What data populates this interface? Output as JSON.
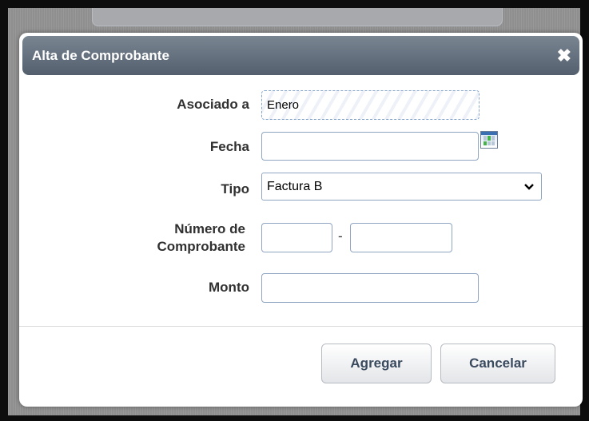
{
  "dialog": {
    "title": "Alta de Comprobante",
    "close_symbol": "✖"
  },
  "form": {
    "asociado_label": "Asociado a",
    "asociado_value": "Enero",
    "fecha_label": "Fecha",
    "fecha_value": "",
    "tipo_label": "Tipo",
    "tipo_selected": "Factura B",
    "numero_label_line1": "Número de",
    "numero_label_line2": "Comprobante",
    "numero_part1": "",
    "numero_separator": "-",
    "numero_part2": "",
    "monto_label": "Monto",
    "monto_value": ""
  },
  "actions": {
    "agregar_label": "Agregar",
    "cancelar_label": "Cancelar"
  },
  "icons": {
    "calendar": "calendar-icon",
    "close": "close-icon",
    "dropdown": "chevron-down-icon"
  }
}
